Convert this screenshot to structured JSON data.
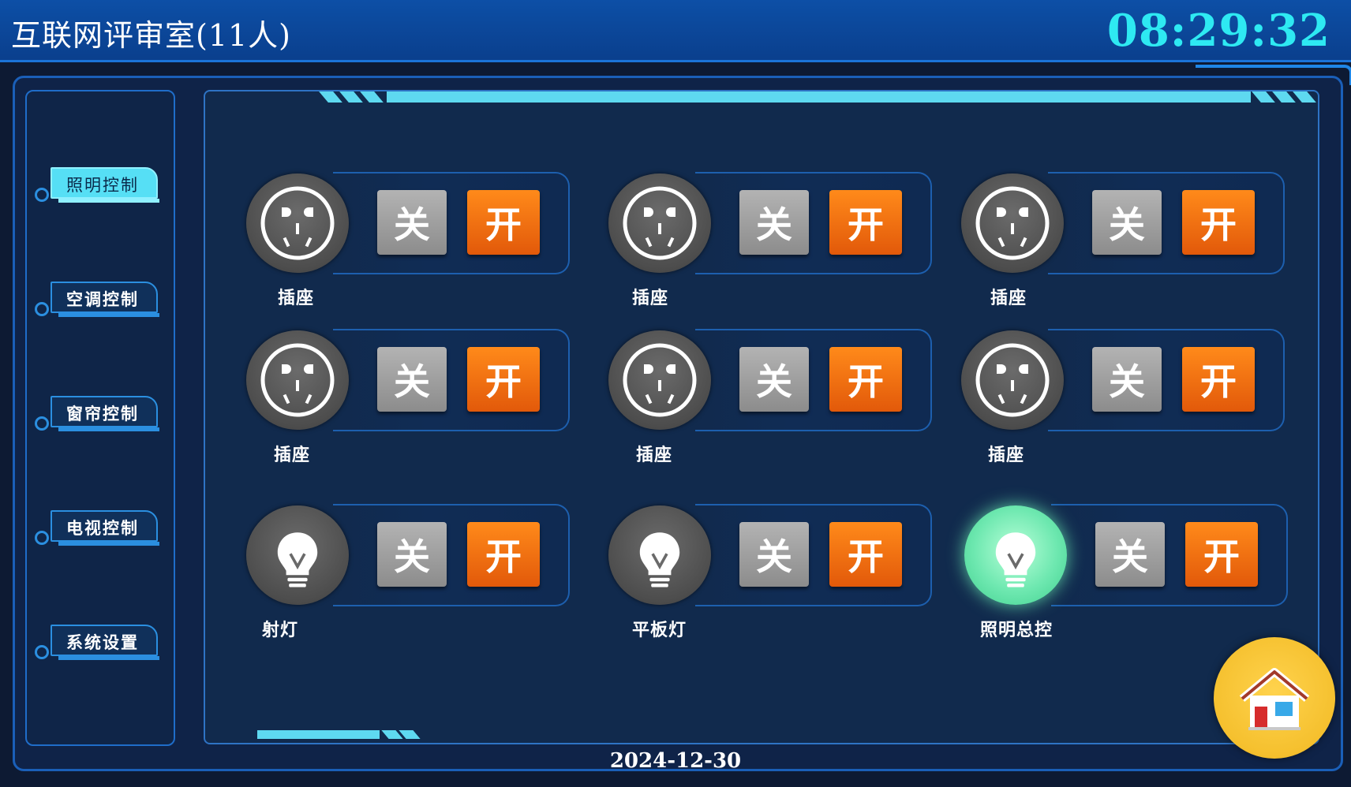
{
  "header": {
    "room_title": "互联网评审室(11人)",
    "time": "08:29:32"
  },
  "sidebar": {
    "items": [
      {
        "label": "照明控制",
        "active": true
      },
      {
        "label": "空调控制",
        "active": false
      },
      {
        "label": "窗帘控制",
        "active": false
      },
      {
        "label": "电视控制",
        "active": false
      },
      {
        "label": "系统设置",
        "active": false
      }
    ]
  },
  "devices": [
    {
      "label": "插座",
      "icon": "socket-icon",
      "on": false,
      "off_label": "关",
      "on_label": "开"
    },
    {
      "label": "插座",
      "icon": "socket-icon",
      "on": false,
      "off_label": "关",
      "on_label": "开"
    },
    {
      "label": "插座",
      "icon": "socket-icon",
      "on": false,
      "off_label": "关",
      "on_label": "开"
    },
    {
      "label": "插座",
      "icon": "socket-icon",
      "on": false,
      "off_label": "关",
      "on_label": "开"
    },
    {
      "label": "插座",
      "icon": "socket-icon",
      "on": false,
      "off_label": "关",
      "on_label": "开"
    },
    {
      "label": "插座",
      "icon": "socket-icon",
      "on": false,
      "off_label": "关",
      "on_label": "开"
    },
    {
      "label": "射灯",
      "icon": "bulb-icon",
      "on": false,
      "off_label": "关",
      "on_label": "开"
    },
    {
      "label": "平板灯",
      "icon": "bulb-icon",
      "on": false,
      "off_label": "关",
      "on_label": "开"
    },
    {
      "label": "照明总控",
      "icon": "bulb-icon",
      "on": true,
      "off_label": "关",
      "on_label": "开"
    }
  ],
  "footer": {
    "date": "2024-12-30"
  },
  "home_button": {
    "icon": "home-icon"
  },
  "colors": {
    "accent_cyan": "#2ee9f2",
    "on_button": "#e2590a",
    "off_button": "#8c8c8c",
    "active_light": "#6ee8b0",
    "home": "#f5c02e"
  }
}
